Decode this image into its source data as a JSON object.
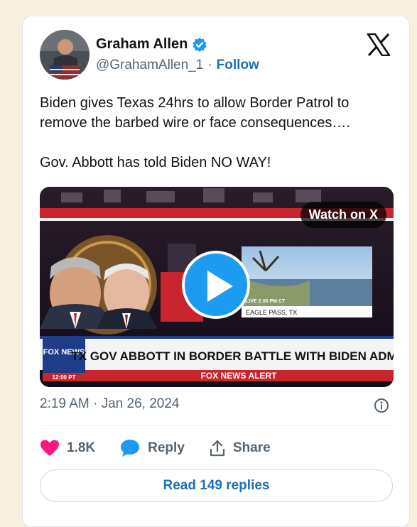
{
  "author": {
    "name": "Graham Allen",
    "handle": "@GrahamAllen_1",
    "separator": "·",
    "follow_label": "Follow",
    "verified": true
  },
  "post": {
    "line1": "Biden gives Texas 24hrs to allow Border Patrol to remove the barbed wire or face consequences….",
    "line2": "Gov. Abbott has told Biden NO WAY!",
    "timestamp": "2:19 AM · Jan 26, 2024"
  },
  "media": {
    "watch_label": "Watch on X",
    "chyron_headline": "TX GOV ABBOTT IN BORDER BATTLE WITH BIDEN ADMIN",
    "alert_label": "FOX NEWS ALERT",
    "network_logo": "FOX NEWS",
    "clock": "12:00 PT",
    "live_tag": "LIVE 2:00 PM CT",
    "location": "EAGLE PASS, TX"
  },
  "actions": {
    "likes_count": "1.8K",
    "reply_label": "Reply",
    "share_label": "Share"
  },
  "read_replies_label": "Read 149 replies",
  "colors": {
    "background": "#f8efe0",
    "accent": "#1d9bf0",
    "link": "#1d6fb8",
    "heart": "#f91880",
    "fox_red": "#d71f2a",
    "fox_blue": "#1f3c88"
  },
  "icons": [
    "verified-badge-icon",
    "x-logo-icon",
    "play-icon",
    "info-icon",
    "heart-icon",
    "reply-bubble-icon",
    "share-icon"
  ]
}
